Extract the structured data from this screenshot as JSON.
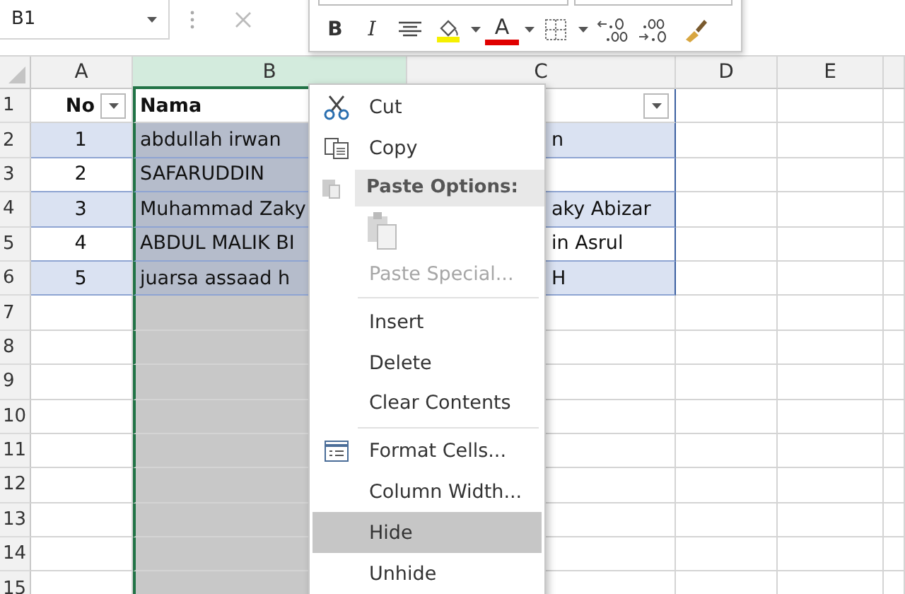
{
  "name_box": {
    "value": "B1"
  },
  "mini_toolbar": [
    {
      "kind": "bold",
      "label": "B"
    },
    {
      "kind": "italic",
      "label": "I"
    },
    {
      "kind": "align"
    },
    {
      "kind": "fill"
    },
    {
      "kind": "caret"
    },
    {
      "kind": "font-color",
      "label": "A"
    },
    {
      "kind": "caret"
    },
    {
      "kind": "borders"
    },
    {
      "kind": "caret"
    },
    {
      "kind": "inc-decimal"
    },
    {
      "kind": "dec-decimal"
    },
    {
      "kind": "painter"
    }
  ],
  "columns": [
    {
      "label": "A",
      "selected": false
    },
    {
      "label": "B",
      "selected": true
    },
    {
      "label": "C",
      "selected": false
    },
    {
      "label": "D",
      "selected": false
    },
    {
      "label": "E",
      "selected": false
    }
  ],
  "rows": [
    {
      "number": "1",
      "header": true,
      "band": false,
      "cells": [
        {
          "text": "No",
          "filter": true
        },
        {
          "text": "Nama",
          "filter": false
        },
        {
          "text": "",
          "filter": true
        }
      ]
    },
    {
      "number": "2",
      "header": false,
      "band": true,
      "cells": [
        {
          "text": "1"
        },
        {
          "text": "abdullah irwan"
        },
        {
          "text": "n"
        }
      ]
    },
    {
      "number": "3",
      "header": false,
      "band": false,
      "cells": [
        {
          "text": "2"
        },
        {
          "text": "SAFARUDDIN"
        },
        {
          "text": ""
        }
      ]
    },
    {
      "number": "4",
      "header": false,
      "band": true,
      "cells": [
        {
          "text": "3"
        },
        {
          "text": "Muhammad Zaky"
        },
        {
          "text": "aky Abizar"
        }
      ]
    },
    {
      "number": "5",
      "header": false,
      "band": false,
      "cells": [
        {
          "text": "4"
        },
        {
          "text": "ABDUL MALIK BI"
        },
        {
          "text": "in Asrul"
        }
      ]
    },
    {
      "number": "6",
      "header": false,
      "band": true,
      "cells": [
        {
          "text": "5"
        },
        {
          "text": "juarsa assaad h"
        },
        {
          "text": "H"
        }
      ]
    },
    {
      "number": "7"
    },
    {
      "number": "8"
    },
    {
      "number": "9"
    },
    {
      "number": "10"
    },
    {
      "number": "11"
    },
    {
      "number": "12"
    },
    {
      "number": "13"
    },
    {
      "number": "14"
    },
    {
      "number": "15"
    }
  ],
  "context_menu": [
    {
      "kind": "item",
      "label": "Cut",
      "disabled": false,
      "selected": false
    },
    {
      "kind": "item",
      "label": "Copy",
      "disabled": false,
      "selected": false
    },
    {
      "kind": "header",
      "label": "Paste Options:"
    },
    {
      "kind": "paste-icons"
    },
    {
      "kind": "item",
      "label": "Paste Special...",
      "disabled": true,
      "selected": false
    },
    {
      "kind": "separator"
    },
    {
      "kind": "item",
      "label": "Insert",
      "disabled": false,
      "selected": false
    },
    {
      "kind": "item",
      "label": "Delete",
      "disabled": false,
      "selected": false
    },
    {
      "kind": "item",
      "label": "Clear Contents",
      "disabled": false,
      "selected": false
    },
    {
      "kind": "separator"
    },
    {
      "kind": "item",
      "label": "Format Cells...",
      "disabled": false,
      "selected": false
    },
    {
      "kind": "item",
      "label": "Column Width...",
      "disabled": false,
      "selected": false
    },
    {
      "kind": "item",
      "label": "Hide",
      "disabled": false,
      "selected": true
    },
    {
      "kind": "item",
      "label": "Unhide",
      "disabled": false,
      "selected": false
    }
  ]
}
